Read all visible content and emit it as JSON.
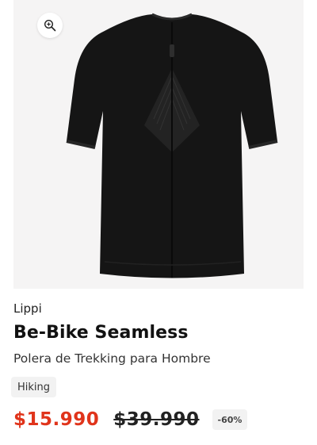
{
  "product": {
    "brand": "Lippi",
    "name": "Be-Bike Seamless",
    "description": "Polera de Trekking para Hombre",
    "tag": "Hiking",
    "price_current": "$15.990",
    "price_original": "$39.990",
    "discount": "-60%",
    "logo_text": "lippi"
  },
  "icons": {
    "zoom": "zoom-in-icon"
  },
  "colors": {
    "price_accent": "#e0341b",
    "panel_bg": "#f5f4f4",
    "garment": "#151515"
  }
}
